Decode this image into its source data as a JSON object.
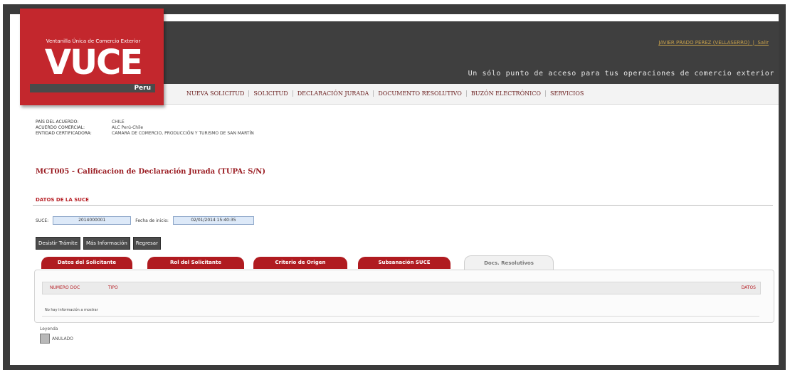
{
  "header": {
    "logo_top": "Ventanilla Única de Comercio Exterior",
    "logo_main": "VUCE",
    "logo_sub": "Peru",
    "user_link": "JAVIER PRADO PEREZ (VELLASERRO)",
    "logout": "Salir",
    "tagline": "Un sólo punto de acceso para tus operaciones de comercio exterior"
  },
  "nav": {
    "items": [
      "NUEVA SOLICITUD",
      "SOLICITUD",
      "DECLARACIÓN JURADA",
      "DOCUMENTO RESOLUTIVO",
      "BUZÓN ELECTRÓNICO",
      "SERVICIOS"
    ]
  },
  "info": {
    "pais_label": "PAÍS DEL ACUERDO:",
    "pais_value": "CHILE",
    "acuerdo_label": "ACUERDO COMERCIAL:",
    "acuerdo_value": "ALC Perú-Chile",
    "entidad_label": "ENTIDAD CERTIFICADORA:",
    "entidad_value": "CAMARA DE COMERCIO, PRODUCCIÓN Y TURISMO DE SAN MARTÍN"
  },
  "page_title": "MCT005 - Calificacion de Declaración Jurada (TUPA: S/N)",
  "section": {
    "title": "DATOS DE LA SUCE",
    "suce_label": "SUCE:",
    "suce_value": "2014000001",
    "fecha_label": "Fecha de inicio:",
    "fecha_value": "02/01/2014 15:40:35"
  },
  "buttons": [
    "Desistir Trámite",
    "Más Información",
    "Regresar"
  ],
  "tabs": [
    {
      "label": "Datos del Solicitante"
    },
    {
      "label": "Rol del Solicitante"
    },
    {
      "label": "Criterio de Origen"
    },
    {
      "label": "Subsanación SUCE"
    },
    {
      "label": "Docs. Resolutivos"
    }
  ],
  "table": {
    "col_numero": "NUMERO DOC",
    "col_tipo": "TIPO",
    "col_datos": "DATOS",
    "empty_message": "No hay información a mostrar"
  },
  "legend": {
    "title": "Leyenda",
    "item": "ANULADO"
  },
  "colors": {
    "brand_red": "#c3272d",
    "header_dark": "#3f3f3f",
    "tab_red": "#b01b20"
  }
}
